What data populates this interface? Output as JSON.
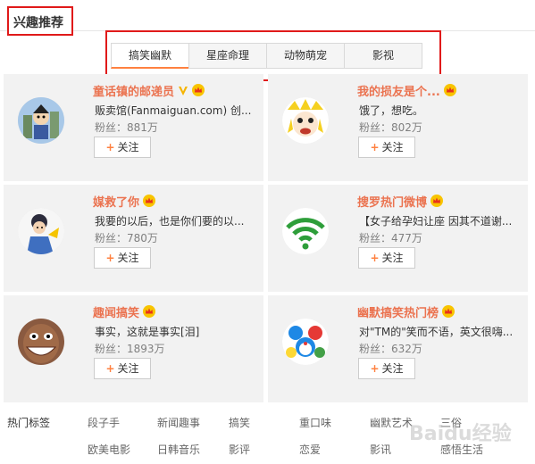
{
  "header": {
    "title": "兴趣推荐"
  },
  "tabs": [
    {
      "label": "搞笑幽默",
      "active": true
    },
    {
      "label": "星座命理",
      "active": false
    },
    {
      "label": "动物萌宠",
      "active": false
    },
    {
      "label": "影视",
      "active": false
    }
  ],
  "follow_label": "关注",
  "cards": [
    {
      "name": "童话镇的邮递员",
      "badges": [
        "v-icon",
        "crown-icon"
      ],
      "desc": "贩卖馆(Fanmaiguan.com) 创...",
      "fans": "粉丝：881万",
      "avatar": "cartoon-robot"
    },
    {
      "name": "我的损友是个...",
      "badges": [
        "crown-icon"
      ],
      "desc": "饿了，想吃。",
      "fans": "粉丝：802万",
      "avatar": "cartoon-girl"
    },
    {
      "name": "媒救了你",
      "badges": [
        "crown-icon"
      ],
      "desc": "我要的以后，也是你们要的以...",
      "fans": "粉丝：780万",
      "avatar": "cartoon-lady"
    },
    {
      "name": "搜罗热门微博",
      "badges": [
        "crown-icon"
      ],
      "desc": "【女子给孕妇让座 因其不道谢...",
      "fans": "粉丝：477万",
      "avatar": "wifi-logo"
    },
    {
      "name": "趣闻搞笑",
      "badges": [
        "crown-icon"
      ],
      "desc": "事实，这就是事实[泪]",
      "fans": "粉丝：1893万",
      "avatar": "cartoon-face"
    },
    {
      "name": "幽默搞笑热门榜",
      "badges": [
        "crown-icon"
      ],
      "desc": "对\"TM的\"笑而不语，英文很嗨...",
      "fans": "粉丝：632万",
      "avatar": "cartoon-group"
    }
  ],
  "hot_tags": {
    "label": "热门标签",
    "row1": [
      "段子手",
      "新闻趣事",
      "搞笑",
      "重口味",
      "幽默艺术",
      "三俗"
    ],
    "row2": [
      "欧美电影",
      "日韩音乐",
      "影评",
      "恋爱",
      "影讯",
      "感悟生活"
    ]
  },
  "watermark": "Baidu经验",
  "colors": {
    "accent": "#ff8140",
    "name": "#eb7350",
    "highlight_box": "#e01a1a",
    "card_bg": "#f2f2f2"
  }
}
